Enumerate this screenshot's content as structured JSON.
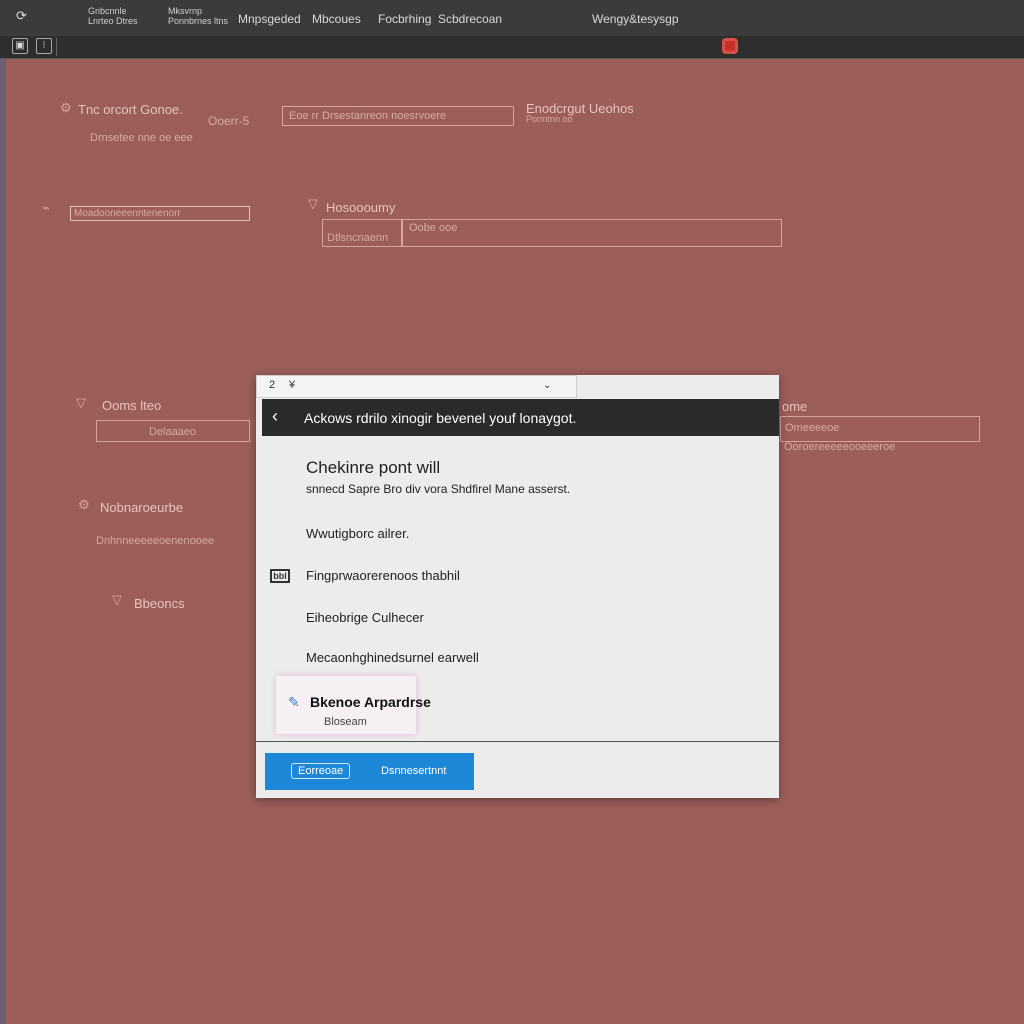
{
  "window": {
    "menu": [
      "Gnbcnnle\nLnrteo Dtres",
      "Mksvrnp\nPonnbrnes ltns",
      "Mnpsgeded",
      "Mbcoues",
      "Focbrhing",
      "Scbdrecoan",
      "Wengy&tesysgp"
    ]
  },
  "background_form": {
    "row1_title": "Tnc orcort Gonoe.",
    "row1_sub": "Drnsetee nne oe eee",
    "row1_badge": "Ooerr-5",
    "row1_field": "Eoe rr Drsestanreon noesrvoere",
    "row1_right_title": "Enodcrgut Ueohos",
    "row1_right_sub": "Pormtnn oo",
    "row2_field": "Moadooneeenntenenorr",
    "row2_title": "Hosoooumy",
    "row2_field_left": "Dtlsncnaenn",
    "row2_field_mid": "Oobe ooe",
    "row3_title": "Ooms lteo",
    "row3_field": "Delaaaeo",
    "row3_right": "ome",
    "row3_right_field": "Omeeeeoe",
    "row3_right_sub": "Ooroereeeeeooeeeroe",
    "row4_title": "Nobnaroeurbe",
    "row4_sub": "Dnhnneeeeeoenenooee",
    "row5_title": "Bbeoncs"
  },
  "dialog": {
    "tab_icons": [
      "2",
      "¥"
    ],
    "title": "Ackows rdrilo xinogir bevenel youf lonaygot.",
    "heading": "Chekinre pont will",
    "subtitle": "snnecd Sapre Bro div vora Shdfirel Mane asserst.",
    "options": [
      "Wwutigborc ailrer.",
      "Fingprwaorerenoos thabhil",
      "Eiheobrige Culhecer",
      "Mecaonhghinedsurnel earwell"
    ],
    "file_icon_text": "bbl",
    "highlight_title": "Bkenoe Arpardrse",
    "highlight_sub": "Bloseam",
    "primary_button": "Eorreoae",
    "secondary_button": "Dsnnesertnnt"
  }
}
